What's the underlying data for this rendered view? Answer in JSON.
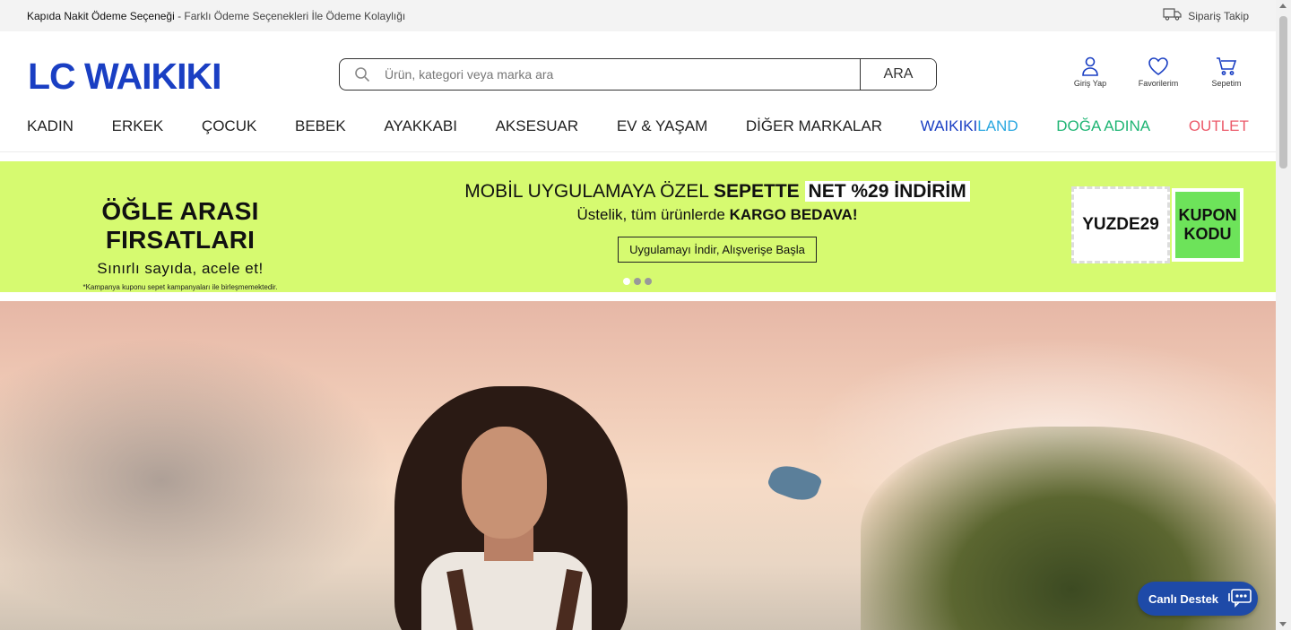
{
  "topbar": {
    "promo_bold": "Kapıda Nakit Ödeme Seçeneği",
    "promo_rest": " - Farklı Ödeme Seçenekleri İle Ödeme Kolaylığı",
    "track_label": "Sipariş Takip",
    "track_icon": "truck-icon"
  },
  "header": {
    "logo_text": "LC WAIKIKI",
    "search": {
      "placeholder": "Ürün, kategori veya marka ara",
      "value": "",
      "button": "ARA"
    },
    "actions": [
      {
        "label": "Giriş Yap",
        "icon": "user-icon"
      },
      {
        "label": "Favorilerim",
        "icon": "heart-icon"
      },
      {
        "label": "Sepetim",
        "icon": "cart-icon"
      }
    ]
  },
  "nav": {
    "items": [
      "KADIN",
      "ERKEK",
      "ÇOCUK",
      "BEBEK",
      "AYAKKABI",
      "AKSESUAR",
      "EV & YAŞAM",
      "DİĞER MARKALAR"
    ],
    "waikikiland_a": "WAIKIKI",
    "waikikiland_b": "LAND",
    "doga": "DOĞA ADINA",
    "outlet": "OUTLET"
  },
  "banner": {
    "title": "ÖĞLE ARASI FIRSATLARI",
    "subtitle": "Sınırlı sayıda, acele et!",
    "note": "*Kampanya kuponu sepet kampanyaları ile birleşmemektedir.",
    "line1_a": "MOBİL UYGULAMAYA ÖZEL ",
    "line1_b": "SEPETTE ",
    "line1_c": "NET %29 İNDİRİM",
    "line2_a": "Üstelik, tüm ürünlerde ",
    "line2_b": "KARGO BEDAVA!",
    "cta": "Uygulamayı İndir, Alışverişe Başla",
    "coupon_code": "YUZDE29",
    "coupon_label_1": "KUPON",
    "coupon_label_2": "KODU",
    "slides_total": 3,
    "active_slide": 1,
    "bg_color": "#d6fa70"
  },
  "live_support": {
    "label": "Canlı Destek",
    "icon": "chat-icon"
  },
  "colors": {
    "brand": "#1a3fc3",
    "doga": "#1fb574",
    "outlet": "#ec5a6a",
    "waikikiland_accent": "#2aa7e0"
  }
}
